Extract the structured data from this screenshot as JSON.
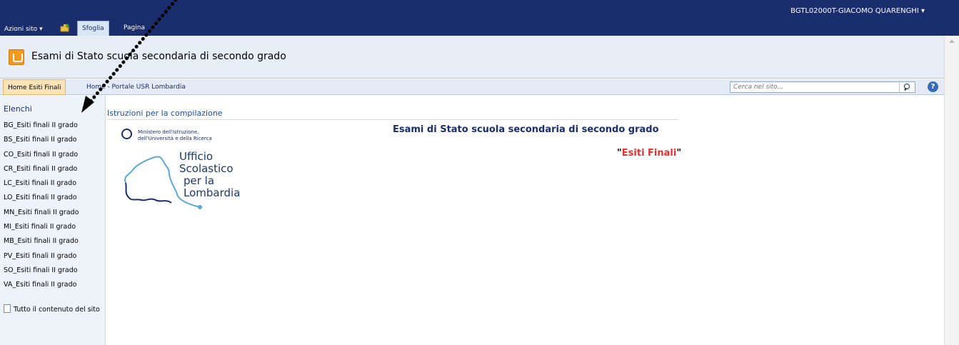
{
  "ribbon": {
    "site_actions": "Azioni sito",
    "tabs": [
      {
        "label": "Sfoglia",
        "active": true
      },
      {
        "label": "Pagina",
        "active": false
      }
    ],
    "user": "BGTL02000T-GIACOMO QUARENGHI"
  },
  "title": {
    "site_title": "Esami di Stato scuola secondaria di secondo grado"
  },
  "topnav": {
    "home_tab": "Home Esiti Finali",
    "usr_link": "Home - Portale USR Lombardia",
    "search_placeholder": "Cerca nel sito..."
  },
  "leftnav": {
    "header": "Elenchi",
    "items": [
      "BG_Esiti finali II grado",
      "BS_Esiti finali II grado",
      "CO_Esiti finali II grado",
      "CR_Esiti finali II grado",
      "LC_Esiti finali II grado",
      "LO_Esiti finali II grado",
      "MN_Esiti finali II grado",
      "MI_Esiti finali II grado",
      "MB_Esiti finali II grado",
      "PV_Esiti finali II grado",
      "SO_Esiti finali II grado",
      "VA_Esiti finali II grado"
    ],
    "all_content": "Tutto il contenuto del sito"
  },
  "main": {
    "section_title": "Istruzioni per la compilazione",
    "logo": {
      "ministry_line1": "Ministero dell'Istruzione,",
      "ministry_line2": "dell'Università e della Ricerca",
      "usr_line1": "Ufficio",
      "usr_line2": "Scolastico",
      "usr_line3": "per la",
      "usr_line4": "Lombardia"
    },
    "heading": "Esami di Stato scuola secondaria di secondo grado",
    "esiti_quote_open": "\"",
    "esiti_label": "Esiti Finali",
    "esiti_quote_close": "\""
  },
  "colors": {
    "ribbon": "#1a2d6c",
    "accent_red": "#e3302f",
    "link": "#1a4fa0"
  }
}
